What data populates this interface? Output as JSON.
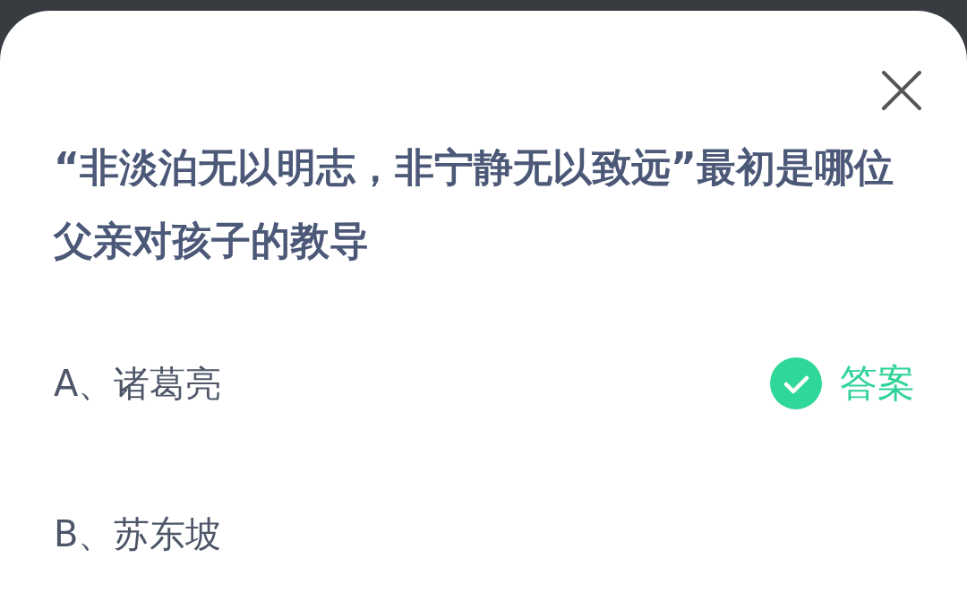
{
  "question": "“非淡泊无以明志，非宁静无以致远”最初是哪位父亲对孩子的教导",
  "answer_label": "答案",
  "options": [
    {
      "text": "A、诸葛亮",
      "correct": true
    },
    {
      "text": "B、苏东坡",
      "correct": false
    }
  ]
}
